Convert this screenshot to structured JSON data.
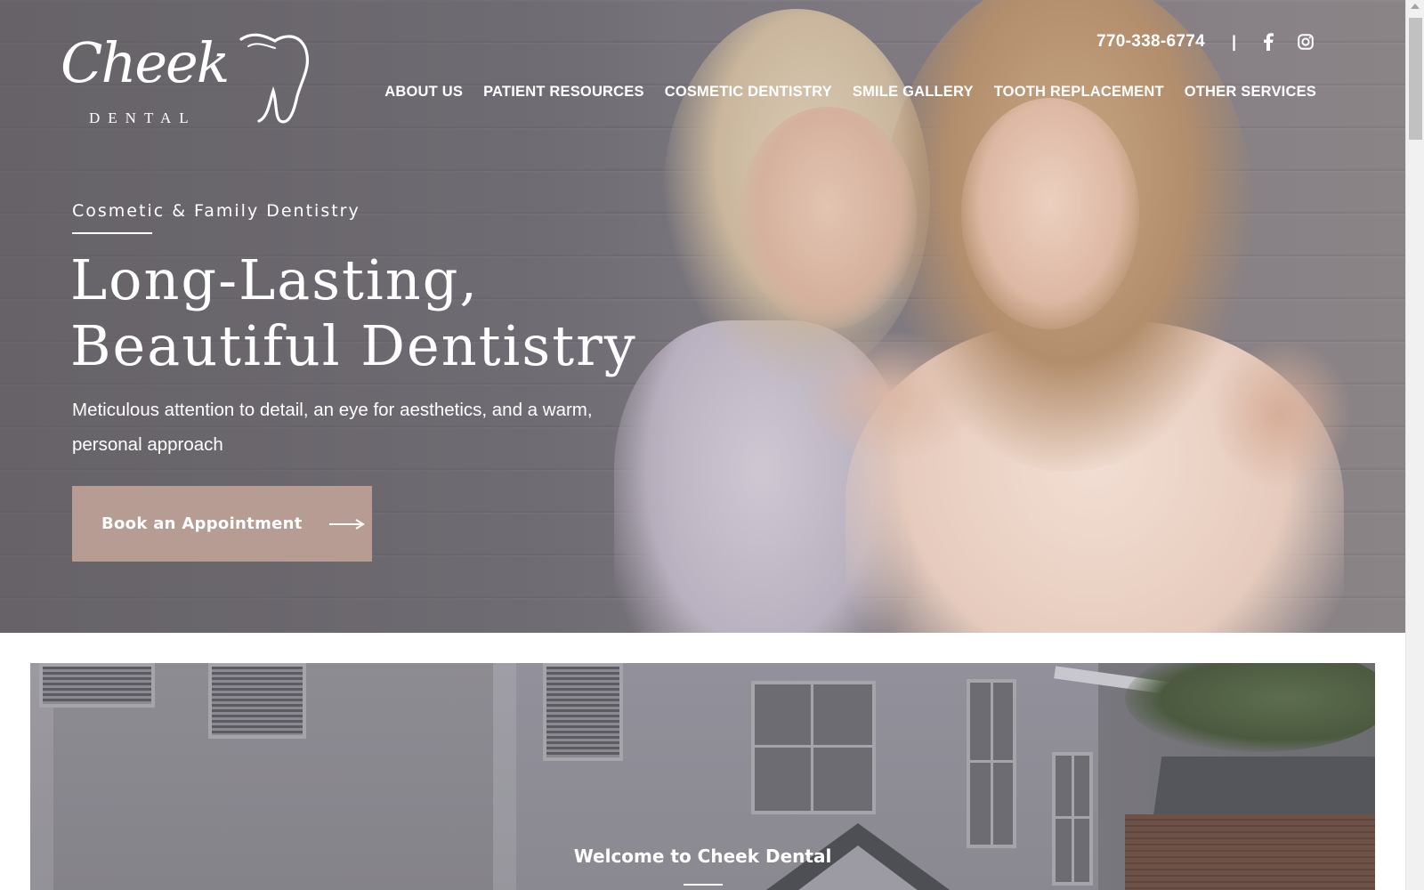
{
  "brand": {
    "logo_word": "Cheek",
    "logo_sub": "DENTAL"
  },
  "topbar": {
    "phone": "770-338-6774",
    "separator": "|",
    "social_icons": [
      "facebook-icon",
      "instagram-icon"
    ]
  },
  "nav": {
    "items": [
      {
        "label": "ABOUT US"
      },
      {
        "label": "PATIENT RESOURCES"
      },
      {
        "label": "COSMETIC DENTISTRY"
      },
      {
        "label": "SMILE GALLERY"
      },
      {
        "label": "TOOTH REPLACEMENT"
      },
      {
        "label": "OTHER SERVICES"
      }
    ]
  },
  "hero": {
    "eyebrow": "Cosmetic & Family Dentistry",
    "headline_line1": "Long-Lasting,",
    "headline_line2": "Beautiful Dentistry",
    "subcopy": "Meticulous attention to detail, an eye for aesthetics, and a warm, personal approach",
    "cta_label": "Book an Appointment",
    "cta_icon": "arrow-right-icon"
  },
  "welcome": {
    "title": "Welcome to Cheek Dental"
  },
  "colors": {
    "accent": "#b69c92",
    "text_on_dark": "#ffffff",
    "page_bg": "#ffffff"
  }
}
